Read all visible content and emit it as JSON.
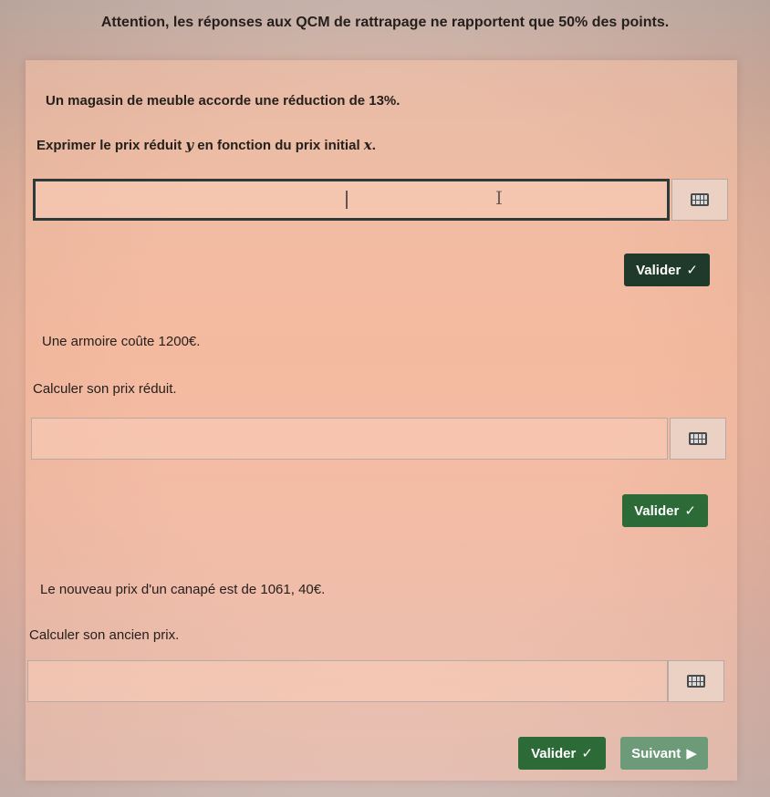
{
  "notice": "Attention, les réponses aux QCM de rattrapage ne rapportent que 50% des points.",
  "intro": "Un magasin de meuble accorde une réduction de 13%.",
  "questions": [
    {
      "prompt_pre": "Exprimer le prix réduit ",
      "var_y": "y",
      "prompt_mid": " en fonction du prix initial ",
      "var_x": "x",
      "prompt_post": ".",
      "answer_value": "",
      "keyboard_icon": "keyboard-icon",
      "validate_label": "Valider",
      "check_glyph": "✓"
    },
    {
      "context": "Une armoire coûte 1200€.",
      "prompt": "Calculer son prix réduit.",
      "answer_value": "",
      "keyboard_icon": "keyboard-icon",
      "validate_label": "Valider",
      "check_glyph": "✓"
    },
    {
      "context": "Le nouveau prix d'un canapé est de 1061, 40€.",
      "prompt": "Calculer son ancien prix.",
      "answer_value": "",
      "keyboard_icon": "keyboard-icon",
      "validate_label": "Valider",
      "check_glyph": "✓"
    }
  ],
  "next_label": "Suivant",
  "next_glyph": "▶",
  "colors": {
    "validate_dark": "#1f3a2a",
    "validate_green": "#2c6a37",
    "next_muted": "#6d9a78"
  }
}
